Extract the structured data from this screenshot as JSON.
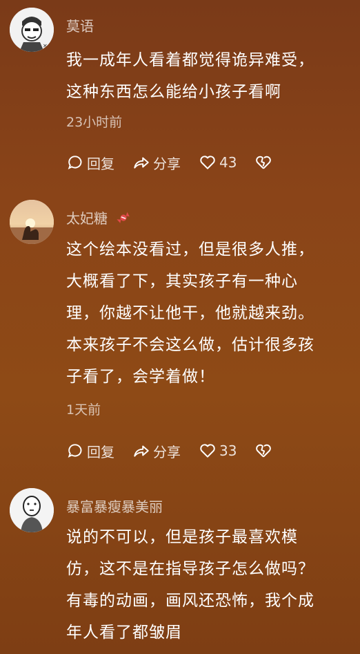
{
  "comments": [
    {
      "username": "莫语",
      "text_lines": [
        "我一成年人看着都觉得诡异难受，",
        "这种东西怎么能给小孩子看啊"
      ],
      "time": "23小时前",
      "reply_label": "回复",
      "share_label": "分享",
      "likes": "43"
    },
    {
      "username": "太妃糖",
      "text_lines": [
        "这个绘本没看过，但是很多人推，",
        "大概看了下，其实孩子有一种心",
        "理，你越不让他干，他就越来劲。",
        "本来孩子不会这么做，估计很多孩",
        "子看了，会学着做！"
      ],
      "time": "1天前",
      "reply_label": "回复",
      "share_label": "分享",
      "likes": "33"
    },
    {
      "username": "暴富暴瘦暴美丽",
      "text_lines": [
        "说的不可以，但是孩子最喜欢模",
        "仿，这不是在指导孩子怎么做吗？",
        "有毒的动画，画风还恐怖，我个成",
        "年人看了都皱眉"
      ]
    }
  ]
}
